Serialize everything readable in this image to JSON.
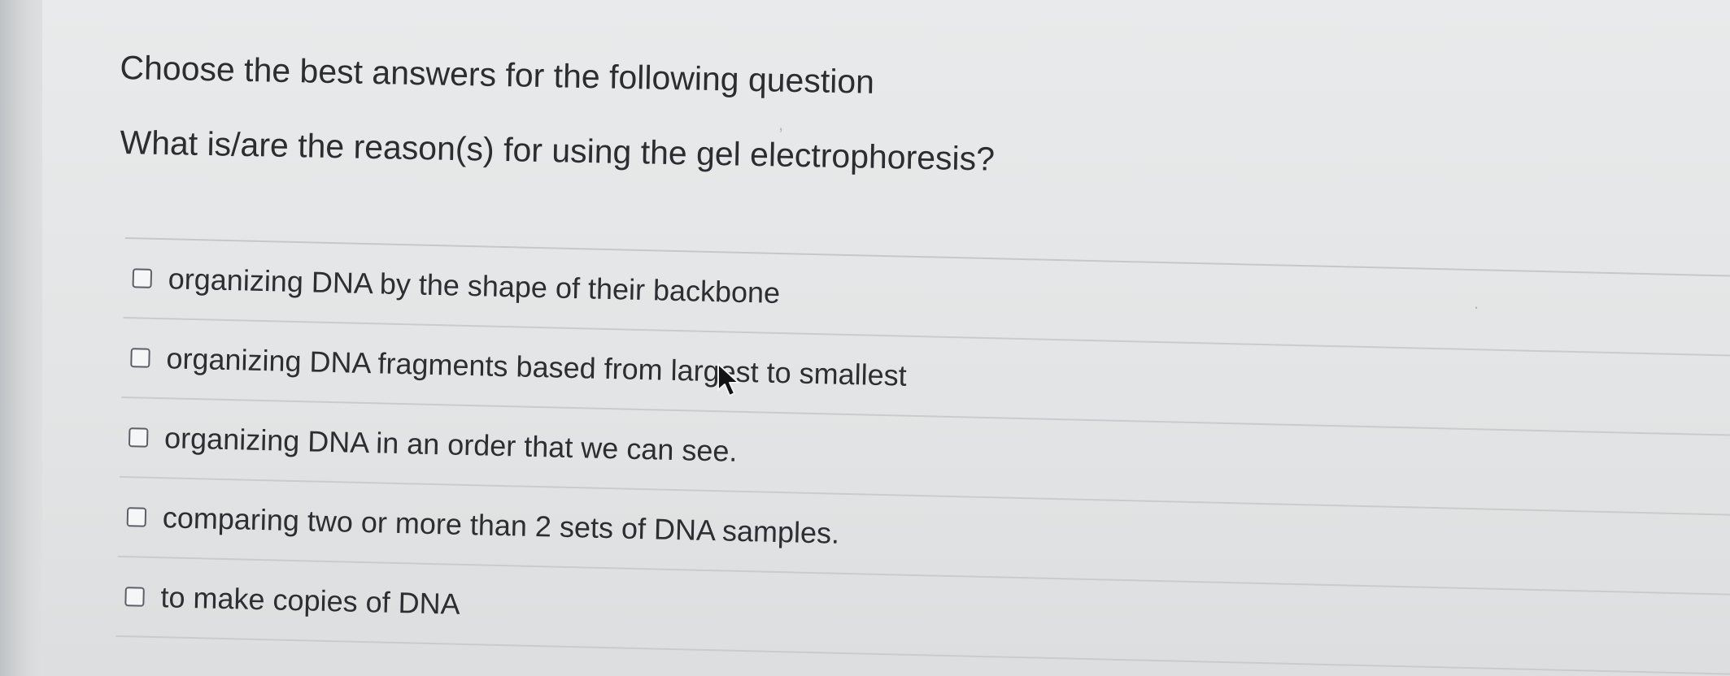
{
  "quiz": {
    "instruction": "Choose the best answers for the following question",
    "question": "What is/are the reason(s) for using the gel electrophoresis?",
    "options": [
      {
        "label": "organizing DNA by the shape of their backbone",
        "checked": false
      },
      {
        "label": "organizing DNA fragments based from largest to smallest",
        "checked": false
      },
      {
        "label": "organizing DNA in an order that we can see.",
        "checked": false
      },
      {
        "label": "comparing two or more than 2 sets of DNA samples.",
        "checked": false
      },
      {
        "label": "to make copies of DNA",
        "checked": false
      }
    ]
  },
  "icons": {
    "pointer": "mouse-pointer-icon",
    "checkbox": "checkbox-unchecked-icon"
  },
  "colors": {
    "text": "#2b2d31",
    "background": "#e4e5e6",
    "divider": "#c6c9cb",
    "checkbox_border": "#5b6067"
  }
}
